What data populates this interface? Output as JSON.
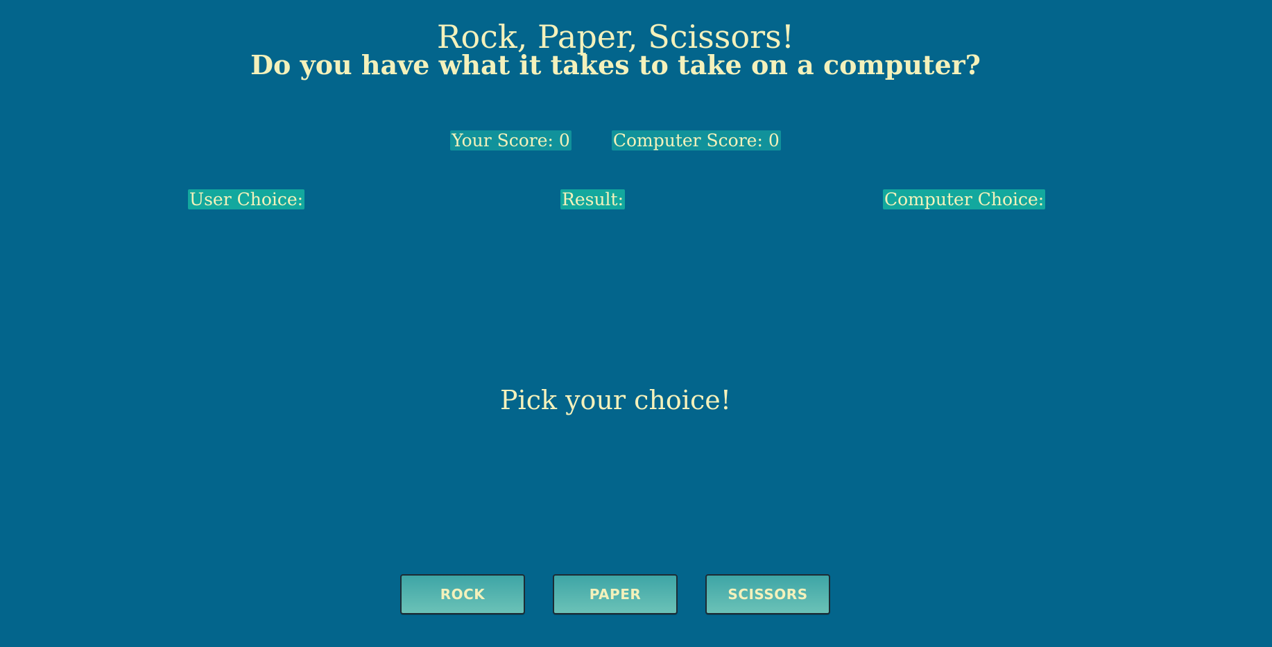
{
  "header": {
    "title": "Rock, Paper, Scissors!",
    "subtitle": "Do you have what it takes to take on a computer?"
  },
  "scoreboard": {
    "your_score_label": "Your Score: 0",
    "computer_score_label": "Computer Score: 0",
    "your_score": 0,
    "computer_score": 0
  },
  "panels": {
    "user_choice_label": "User Choice:",
    "result_label": "Result:",
    "computer_choice_label": "Computer Choice:"
  },
  "message": "Pick your choice!",
  "buttons": {
    "rock": "ROCK",
    "paper": "PAPER",
    "scissors": "SCISSORS"
  },
  "colors": {
    "background": "#03658c",
    "text": "#f4f1bb",
    "label_background": "#13a89e",
    "button_gradient_top": "#3ea5a6",
    "button_gradient_bottom": "#6bc2b7"
  }
}
